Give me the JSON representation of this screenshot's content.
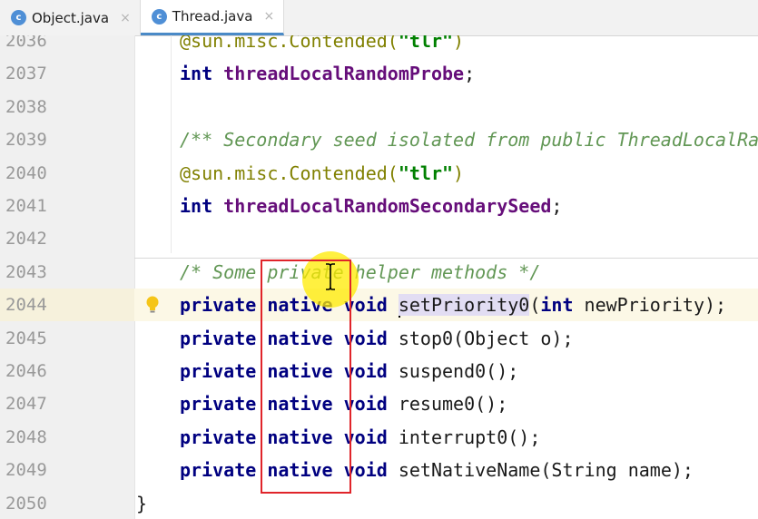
{
  "tabs": [
    {
      "label": "Object.java",
      "icon": "class-c-icon",
      "active": false
    },
    {
      "label": "Thread.java",
      "icon": "class-c-icon",
      "active": true
    }
  ],
  "class_icon_letter": "c",
  "close_glyph": "×",
  "current_line": "2044",
  "lines": [
    {
      "num": "2036",
      "tokens": [
        [
          "ann",
          "@sun.misc.Contended("
        ],
        [
          "str",
          "\"tlr\""
        ],
        [
          "ann",
          ")"
        ]
      ]
    },
    {
      "num": "2037",
      "tokens": [
        [
          "kw",
          "int "
        ],
        [
          "field",
          "threadLocalRandomProbe"
        ],
        [
          "plain",
          ";"
        ]
      ]
    },
    {
      "num": "2038",
      "tokens": []
    },
    {
      "num": "2039",
      "tokens": [
        [
          "cmt",
          "/** Secondary seed isolated from public ThreadLocalRandom sequence */"
        ]
      ]
    },
    {
      "num": "2040",
      "tokens": [
        [
          "ann",
          "@sun.misc.Contended("
        ],
        [
          "str",
          "\"tlr\""
        ],
        [
          "ann",
          ")"
        ]
      ]
    },
    {
      "num": "2041",
      "tokens": [
        [
          "kw",
          "int "
        ],
        [
          "field",
          "threadLocalRandomSecondarySeed"
        ],
        [
          "plain",
          ";"
        ]
      ]
    },
    {
      "num": "2042",
      "tokens": []
    },
    {
      "num": "2043",
      "tokens": [
        [
          "cmt",
          "/* Some private helper methods */"
        ]
      ]
    },
    {
      "num": "2044",
      "tokens": [
        [
          "kw",
          "private native void "
        ],
        [
          "hl",
          "setPriority0"
        ],
        [
          "plain",
          "("
        ],
        [
          "kw",
          "int "
        ],
        [
          "plain",
          "newPriority);"
        ]
      ]
    },
    {
      "num": "2045",
      "tokens": [
        [
          "kw",
          "private native void "
        ],
        [
          "plain",
          "stop0(Object o);"
        ]
      ]
    },
    {
      "num": "2046",
      "tokens": [
        [
          "kw",
          "private native void "
        ],
        [
          "plain",
          "suspend0();"
        ]
      ]
    },
    {
      "num": "2047",
      "tokens": [
        [
          "kw",
          "private native void "
        ],
        [
          "plain",
          "resume0();"
        ]
      ]
    },
    {
      "num": "2048",
      "tokens": [
        [
          "kw",
          "private native void "
        ],
        [
          "plain",
          "interrupt0();"
        ]
      ]
    },
    {
      "num": "2049",
      "tokens": [
        [
          "kw",
          "private native void "
        ],
        [
          "plain",
          "setNativeName(String name);"
        ]
      ]
    },
    {
      "num": "2050",
      "tokens": [
        [
          "brace",
          "}"
        ]
      ]
    }
  ],
  "colors": {
    "keyword": "#000080",
    "field": "#660e7a",
    "string": "#008000",
    "annotation": "#808000",
    "comment": "#629755",
    "highlight_box": "#e0242a",
    "cursor_glow": "#ffeb00"
  }
}
